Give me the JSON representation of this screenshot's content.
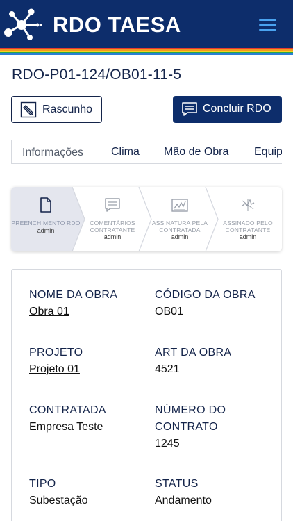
{
  "app": {
    "brand": "RDO TAESA",
    "icons": {
      "logo": "molecule-logo-icon",
      "menu": "hamburger-menu-icon"
    },
    "colors": {
      "header": "#0d2d6b",
      "accent": "#4aa3f0",
      "stripes": [
        "#e53b2f",
        "#f39a1e",
        "#f6d21f",
        "#27a54a",
        "#2a7fd4"
      ]
    }
  },
  "rdo": {
    "code": "RDO-P01-124/OB01-11-5"
  },
  "actions": {
    "draft_label": "Rascunho",
    "draft_icon": "edit-document-icon",
    "conclude_label": "Concluir RDO",
    "conclude_icon": "comment-icon"
  },
  "tabs": [
    {
      "label": "Informações",
      "active": true
    },
    {
      "label": "Clima",
      "active": false
    },
    {
      "label": "Mão de Obra",
      "active": false
    },
    {
      "label": "Equipamentos",
      "active": false
    }
  ],
  "steps": [
    {
      "title": "PREENCHIMENTO RDO",
      "user": "admin",
      "icon": "document-icon",
      "current": true
    },
    {
      "title": "COMENTÁRIOS CONTRATANTE",
      "user": "admin",
      "icon": "comment-icon",
      "current": false
    },
    {
      "title": "ASSINATURA PELA CONTRATADA",
      "user": "admin",
      "icon": "signature-icon",
      "current": false
    },
    {
      "title": "ASSINADO PELO CONTRATANTE",
      "user": "admin",
      "icon": "signed-icon",
      "current": false
    }
  ],
  "info": {
    "obra_nome_label": "NOME DA OBRA",
    "obra_nome": "Obra 01",
    "obra_codigo_label": "CÓDIGO DA OBRA",
    "obra_codigo": "OB01",
    "projeto_label": "PROJETO",
    "projeto": "Projeto 01",
    "art_label": "ART DA OBRA",
    "art": "4521",
    "contratada_label": "CONTRATADA",
    "contratada": "Empresa Teste",
    "contrato_label_1": "NÚMERO DO",
    "contrato_label_2": "CONTRATO",
    "contrato": "1245",
    "tipo_label": "TIPO",
    "tipo": "Subestação",
    "status_label": "STATUS",
    "status": "Andamento"
  }
}
